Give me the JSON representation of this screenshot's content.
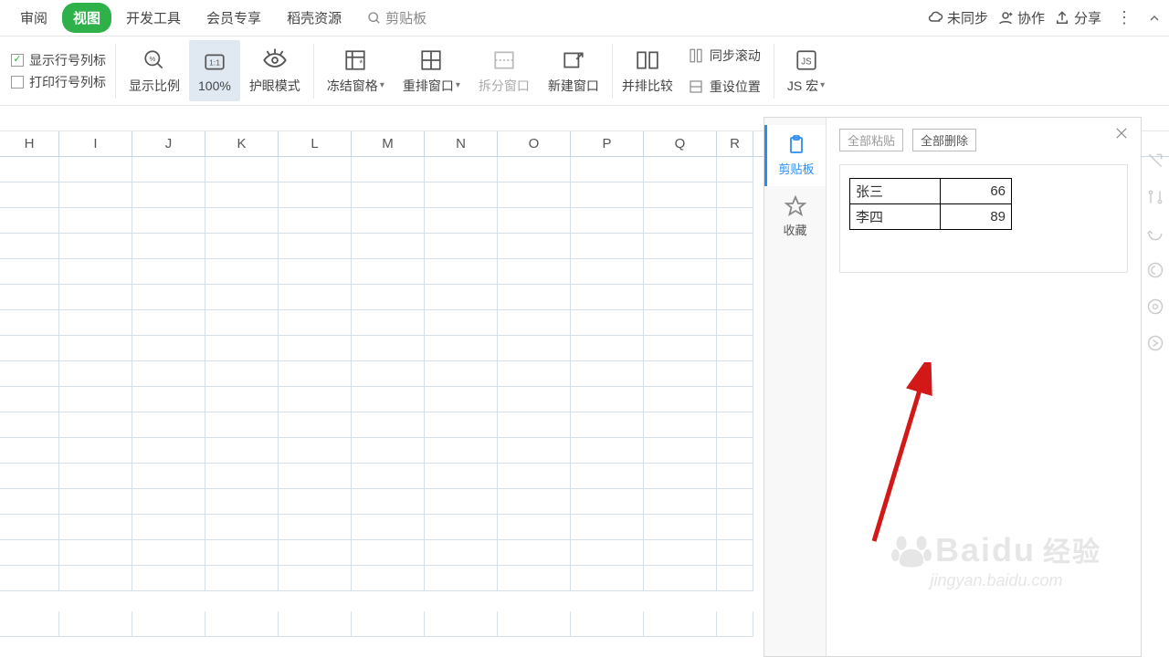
{
  "menu": {
    "tabs": [
      "审阅",
      "视图",
      "开发工具",
      "会员专享",
      "稻壳资源"
    ],
    "active_index": 1,
    "clipboard_btn": "剪贴板",
    "right": {
      "unsynced": "未同步",
      "collab": "协作",
      "share": "分享"
    }
  },
  "ribbon": {
    "show_row_col_label": "显示行号列标",
    "print_row_col_label": "打印行号列标",
    "show_row_col_checked": true,
    "print_row_col_checked": false,
    "display_ratio": "显示比例",
    "zoom_value": "100%",
    "eye_mode": "护眼模式",
    "freeze": "冻结窗格",
    "arrange": "重排窗口",
    "split": "拆分窗口",
    "new_window": "新建窗口",
    "side_by_side": "并排比较",
    "sync_scroll": "同步滚动",
    "reset_pos": "重设位置",
    "js_macro": "JS 宏"
  },
  "columns": [
    "H",
    "I",
    "J",
    "K",
    "L",
    "M",
    "N",
    "O",
    "P",
    "Q",
    "R"
  ],
  "panel": {
    "side_clip": "剪贴板",
    "side_fav": "收藏",
    "paste_all": "全部粘贴",
    "delete_all": "全部删除",
    "rows": [
      {
        "name": "张三",
        "value": "66"
      },
      {
        "name": "李四",
        "value": "89"
      }
    ]
  },
  "watermark": {
    "brand": "Baidu",
    "suffix": "经验",
    "url": "jingyan.baidu.com"
  }
}
